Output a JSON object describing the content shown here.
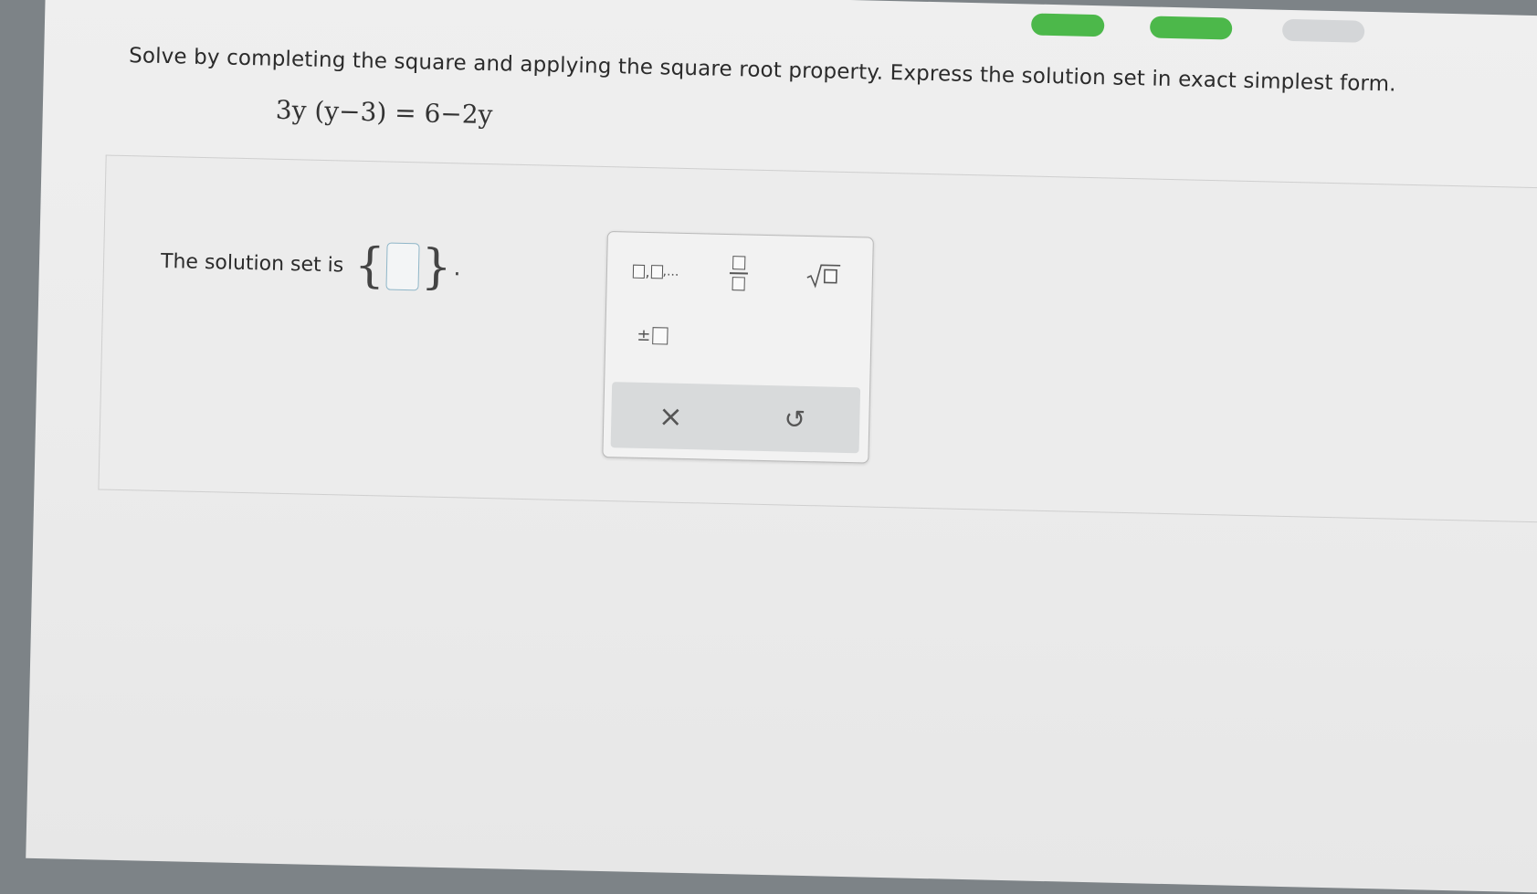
{
  "prompt": "Solve by completing the square and applying the square root property. Express the solution set in exact simplest form.",
  "equation": "3y (y−3) = 6−2y",
  "solution_label": "The solution set is",
  "brace_open": "{",
  "brace_close": "}",
  "period": ".",
  "palette": {
    "list_button": "□,□,...",
    "fraction_button": "fraction",
    "sqrt_button": "√□",
    "plusminus_button": "±□",
    "clear_symbol": "×",
    "undo_symbol": "↺"
  },
  "colors": {
    "accent_green": "#4cb84a",
    "answer_box_border": "#8fb6c8"
  }
}
